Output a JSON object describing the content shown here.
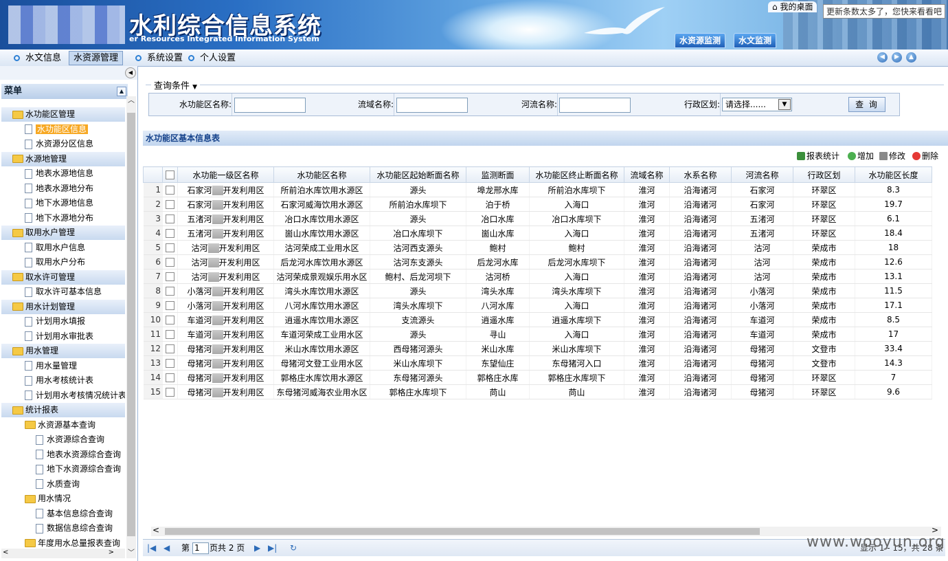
{
  "banner": {
    "title": "水利综合信息系统",
    "subtitle": "er Resources Integrated Information System",
    "tabs": [
      "水资源监测",
      "水文监测"
    ],
    "desk_link": "我的桌面",
    "tooltip": "更新条数太多了，您快来看看吧"
  },
  "nav": {
    "items": [
      "水文信息",
      "水资源管理",
      "系统设置",
      "个人设置"
    ],
    "active": "水资源管理"
  },
  "sidebar": {
    "menu_title": "菜单",
    "tree": [
      {
        "label": "水功能区管理",
        "type": "group"
      },
      {
        "label": "水功能区信息",
        "type": "leaf",
        "selected": true
      },
      {
        "label": "水资源分区信息",
        "type": "leaf"
      },
      {
        "label": "水源地管理",
        "type": "group"
      },
      {
        "label": "地表水源地信息",
        "type": "leaf"
      },
      {
        "label": "地表水源地分布",
        "type": "leaf"
      },
      {
        "label": "地下水源地信息",
        "type": "leaf"
      },
      {
        "label": "地下水源地分布",
        "type": "leaf"
      },
      {
        "label": "取用水户管理",
        "type": "group"
      },
      {
        "label": "取用水户信息",
        "type": "leaf"
      },
      {
        "label": "取用水户分布",
        "type": "leaf"
      },
      {
        "label": "取水许可管理",
        "type": "group"
      },
      {
        "label": "取水许可基本信息",
        "type": "leaf"
      },
      {
        "label": "用水计划管理",
        "type": "group"
      },
      {
        "label": "计划用水填报",
        "type": "leaf"
      },
      {
        "label": "计划用水审批表",
        "type": "leaf"
      },
      {
        "label": "用水管理",
        "type": "group"
      },
      {
        "label": "用水量管理",
        "type": "leaf"
      },
      {
        "label": "用水考核统计表",
        "type": "leaf"
      },
      {
        "label": "计划用水考核情况统计表",
        "type": "leaf"
      },
      {
        "label": "统计报表",
        "type": "group"
      },
      {
        "label": "水资源基本查询",
        "type": "subgroup"
      },
      {
        "label": "水资源综合查询",
        "type": "subleaf"
      },
      {
        "label": "地表水资源综合查询",
        "type": "subleaf"
      },
      {
        "label": "地下水资源综合查询",
        "type": "subleaf"
      },
      {
        "label": "水质查询",
        "type": "subleaf"
      },
      {
        "label": "用水情况",
        "type": "subgroup"
      },
      {
        "label": "基本信息综合查询",
        "type": "subleaf"
      },
      {
        "label": "数据信息综合查询",
        "type": "subleaf"
      },
      {
        "label": "年度用水总量报表查询",
        "type": "subgroup"
      }
    ]
  },
  "query": {
    "legend": "查询条件",
    "fields": {
      "zone_name_label": "水功能区名称:",
      "basin_label": "流域名称:",
      "river_label": "河流名称:",
      "region_label": "行政区划:",
      "region_selected": "请选择......"
    },
    "button": "查 询"
  },
  "grid": {
    "title": "水功能区基本信息表",
    "toolbar": [
      "报表统计",
      "增加",
      "修改",
      "删除"
    ],
    "columns": [
      "水功能一级区名称",
      "水功能区名称",
      "水功能区起始断面名称",
      "监测断面",
      "水功能区终止断面名称",
      "流域名称",
      "水系名称",
      "河流名称",
      "行政区划",
      "水功能区长度"
    ],
    "rows": [
      [
        "石家河",
        "开发利用区",
        "所前泊水库饮用水源区",
        "源头",
        "埠龙邢水库",
        "所前泊水库坝下",
        "淮河",
        "沿海诸河",
        "石家河",
        "环翠区",
        "8.3"
      ],
      [
        "石家河",
        "开发利用区",
        "石家河威海饮用水源区",
        "所前泊水库坝下",
        "泊于桥",
        "入海口",
        "淮河",
        "沿海诸河",
        "石家河",
        "环翠区",
        "19.7"
      ],
      [
        "五渚河",
        "开发利用区",
        "冶口水库饮用水源区",
        "源头",
        "冶口水库",
        "冶口水库坝下",
        "淮河",
        "沿海诸河",
        "五渚河",
        "环翠区",
        "6.1"
      ],
      [
        "五渚河",
        "开发利用区",
        "崮山水库饮用水源区",
        "冶口水库坝下",
        "崮山水库",
        "入海口",
        "淮河",
        "沿海诸河",
        "五渚河",
        "环翠区",
        "18.4"
      ],
      [
        "沽河",
        "开发利用区",
        "沽河荣成工业用水区",
        "沽河西支源头",
        "鲍村",
        "鲍村",
        "淮河",
        "沿海诸河",
        "沽河",
        "荣成市",
        "18"
      ],
      [
        "沽河",
        "开发利用区",
        "后龙河水库饮用水源区",
        "沽河东支源头",
        "后龙河水库",
        "后龙河水库坝下",
        "淮河",
        "沿海诸河",
        "沽河",
        "荣成市",
        "12.6"
      ],
      [
        "沽河",
        "开发利用区",
        "沽河荣成景观娱乐用水区",
        "鲍村、后龙河坝下",
        "沽河桥",
        "入海口",
        "淮河",
        "沿海诸河",
        "沽河",
        "荣成市",
        "13.1"
      ],
      [
        "小落河",
        "开发利用区",
        "湾头水库饮用水源区",
        "源头",
        "湾头水库",
        "湾头水库坝下",
        "淮河",
        "沿海诸河",
        "小落河",
        "荣成市",
        "11.5"
      ],
      [
        "小落河",
        "开发利用区",
        "八河水库饮用水源区",
        "湾头水库坝下",
        "八河水库",
        "入海口",
        "淮河",
        "沿海诸河",
        "小落河",
        "荣成市",
        "17.1"
      ],
      [
        "车道河",
        "开发利用区",
        "逍遥水库饮用水源区",
        "支流源头",
        "逍遥水库",
        "逍遥水库坝下",
        "淮河",
        "沿海诸河",
        "车道河",
        "荣成市",
        "8.5"
      ],
      [
        "车道河",
        "开发利用区",
        "车道河荣成工业用水区",
        "源头",
        "寻山",
        "入海口",
        "淮河",
        "沿海诸河",
        "车道河",
        "荣成市",
        "17"
      ],
      [
        "母猪河",
        "开发利用区",
        "米山水库饮用水源区",
        "西母猪河源头",
        "米山水库",
        "米山水库坝下",
        "淮河",
        "沿海诸河",
        "母猪河",
        "文登市",
        "33.4"
      ],
      [
        "母猪河",
        "开发利用区",
        "母猪河文登工业用水区",
        "米山水库坝下",
        "东望仙庄",
        "东母猪河入口",
        "淮河",
        "沿海诸河",
        "母猪河",
        "文登市",
        "14.3"
      ],
      [
        "母猪河",
        "开发利用区",
        "郭格庄水库饮用水源区",
        "东母猪河源头",
        "郭格庄水库",
        "郭格庄水库坝下",
        "淮河",
        "沿海诸河",
        "母猪河",
        "环翠区",
        "7"
      ],
      [
        "母猪河",
        "开发利用区",
        "东母猪河威海农业用水区",
        "郭格庄水库坝下",
        "苘山",
        "苘山",
        "淮河",
        "沿海诸河",
        "母猪河",
        "环翠区",
        "9.6"
      ]
    ]
  },
  "pager": {
    "page_prefix": "第",
    "page_value": "1",
    "page_suffix": "页共 2 页",
    "display_info": "显示 1 - 15，共 28 条"
  },
  "watermark": "www.wooyun.org"
}
